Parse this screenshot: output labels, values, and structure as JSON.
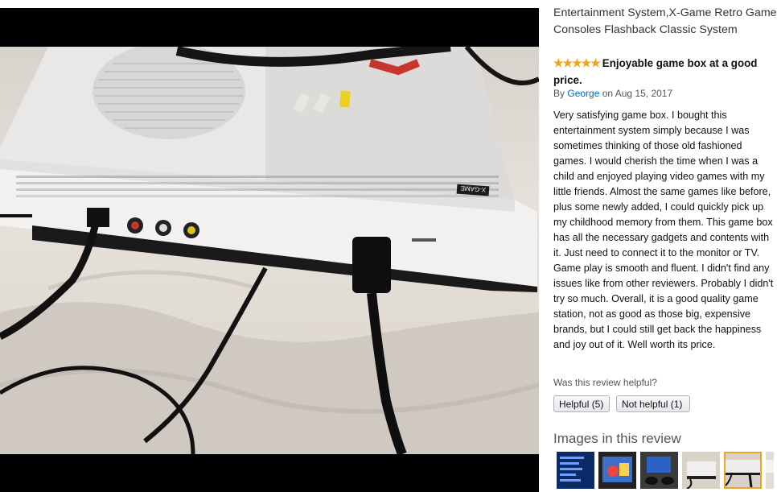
{
  "review": {
    "product_title": "Entertainment System,X-Game Retro Game Consoles Flashback Classic System",
    "stars_glyphs": "★★★★★",
    "rating": 5,
    "headline": "Enjoyable game box at a good price.",
    "by_prefix": "By",
    "author": "George",
    "date_text": "on Aug 15, 2017",
    "body": "Very satisfying game box. I bought this entertainment system simply because I was sometimes thinking of those old fashioned games. I would cherish the time when I was a child and enjoyed playing video games with my little friends. Almost the same games like before, plus some newly added, I could quickly pick up my childhood memory from them. This game box has all the necessary gadgets and contents with it. Just need to connect it to the monitor or TV. Game play is smooth and fluent. I didn't find any issues like from other reviewers. Probably I didn't try so much. Overall, it is a good quality game station, not as good as those big, expensive brands, but I could still get back the happiness and joy out of it. Well worth its price.",
    "helpful_question": "Was this review helpful?",
    "helpful_button": "Helpful (5)",
    "not_helpful_button": "Not helpful (1)"
  },
  "images_section": {
    "heading": "Images in this review",
    "thumbnails": [
      {
        "name": "thumb-game-menu",
        "selected": false
      },
      {
        "name": "thumb-game-screen",
        "selected": false
      },
      {
        "name": "thumb-console-controllers",
        "selected": false
      },
      {
        "name": "thumb-console-box",
        "selected": false
      },
      {
        "name": "thumb-console-cables",
        "selected": true
      },
      {
        "name": "thumb-console-rear",
        "selected": false
      }
    ]
  },
  "viewer": {
    "console_brand_text": "X-GAME"
  },
  "colors": {
    "star": "#f0a419",
    "link": "#0066c0",
    "selected_thumb_border": "#e8a825"
  }
}
